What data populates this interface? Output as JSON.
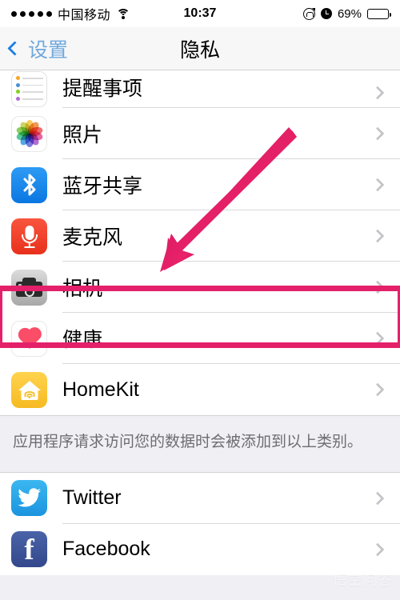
{
  "status_bar": {
    "signal_dots": 5,
    "carrier": "中国移动",
    "wifi_icon": "wifi-icon",
    "time": "10:37",
    "rotation_lock_icon": "rotation-lock-icon",
    "alarm_icon": "alarm-clock-icon",
    "battery_percent": "69%",
    "battery_level": 69
  },
  "nav_bar": {
    "back_label": "设置",
    "back_icon": "chevron-left-icon",
    "title": "隐私"
  },
  "section1": {
    "rows": [
      {
        "label": "提醒事项",
        "icon": "reminders-icon",
        "partial": true
      },
      {
        "label": "照片",
        "icon": "photos-icon"
      },
      {
        "label": "蓝牙共享",
        "icon": "bluetooth-icon"
      },
      {
        "label": "麦克风",
        "icon": "microphone-icon"
      },
      {
        "label": "相机",
        "icon": "camera-icon",
        "highlighted": true
      },
      {
        "label": "健康",
        "icon": "health-icon"
      },
      {
        "label": "HomeKit",
        "icon": "homekit-icon"
      }
    ]
  },
  "footer": {
    "text": "应用程序请求访问您的数据时会被添加到以上类别。"
  },
  "section2": {
    "rows": [
      {
        "label": "Twitter",
        "icon": "twitter-icon"
      },
      {
        "label": "Facebook",
        "icon": "facebook-icon"
      }
    ]
  },
  "annotations": {
    "highlight_color": "#E4206A",
    "arrow_color": "#E4206A",
    "arrow_target": "相机",
    "watermark_text": "悟空问答"
  },
  "colors": {
    "accent_blue": "#1C7FE0",
    "back_label_blue": "#6FA8DC",
    "list_bg": "#FFFFFF",
    "page_bg": "#EFEFF4",
    "separator": "#D9D9DD",
    "footer_text": "#6D6D72",
    "chevron": "#C4C4C8"
  }
}
